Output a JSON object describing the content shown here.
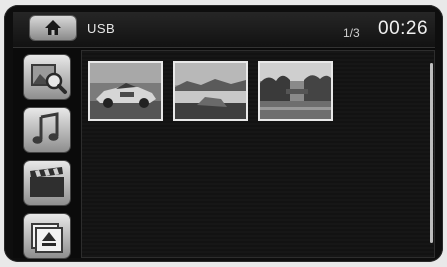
{
  "header": {
    "source_label": "USB",
    "page_indicator": "1/3",
    "clock": "00:26"
  },
  "sidebar": {
    "items": [
      {
        "icon": "photo-search-icon"
      },
      {
        "icon": "music-note-icon"
      },
      {
        "icon": "clapperboard-icon"
      },
      {
        "icon": "eject-photos-icon"
      }
    ]
  },
  "gallery": {
    "thumbnails": [
      {
        "subject": "race-car"
      },
      {
        "subject": "lake-landscape"
      },
      {
        "subject": "river-trees"
      }
    ]
  }
}
